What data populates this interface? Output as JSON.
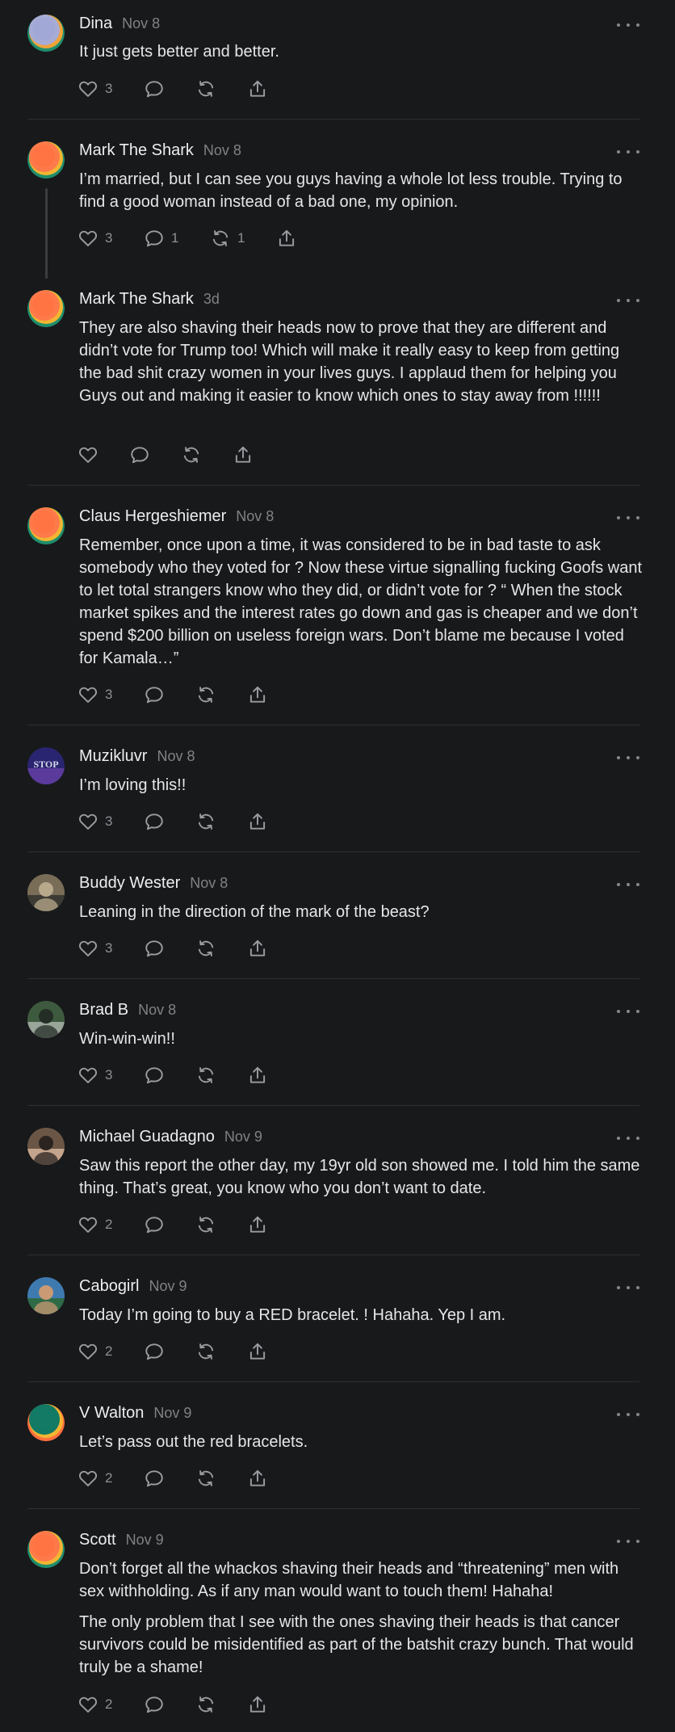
{
  "theme": {
    "background": "#18191b",
    "text": "#e9e9ea",
    "muted": "#808285",
    "divider": "#2e2f32"
  },
  "icons": {
    "like": "heart-icon",
    "reply": "comment-icon",
    "repost": "repost-icon",
    "share": "share-icon",
    "more": "more-icon"
  },
  "posts": [
    {
      "author": "Dina",
      "date": "Nov 8",
      "paragraphs": [
        "It just gets better and better."
      ],
      "likes": "3",
      "replies": "",
      "reposts": ""
    },
    {
      "author": "Mark The Shark",
      "date": "Nov 8",
      "paragraphs": [
        "I’m married, but I can see you guys having a whole lot less trouble. Trying to find a good woman instead of a bad one, my opinion."
      ],
      "likes": "3",
      "replies": "1",
      "reposts": "1"
    },
    {
      "author": "Mark The Shark",
      "date": "3d",
      "paragraphs": [
        "They are also shaving their heads now to prove that they are different and didn’t vote for Trump too! Which will make it really easy to keep from getting the bad shit crazy women in your lives guys. I applaud them for helping you Guys out and making it easier to know which ones to stay away from !!!!!!"
      ],
      "likes": "",
      "replies": "",
      "reposts": ""
    },
    {
      "author": "Claus Hergeshiemer",
      "date": "Nov 8",
      "paragraphs": [
        "Remember, once upon a time, it was considered to be in bad taste to ask somebody who they voted for ? Now these virtue signalling fucking Goofs want to let total strangers know who they did, or didn’t vote for ? “ When the stock market spikes and the interest rates go down and gas is cheaper and we don’t spend $200 billion on useless foreign wars. Don’t blame me because I voted for Kamala…”"
      ],
      "likes": "3",
      "replies": "",
      "reposts": ""
    },
    {
      "author": "Muzikluvr",
      "date": "Nov 8",
      "paragraphs": [
        "I’m loving this!!"
      ],
      "likes": "3",
      "replies": "",
      "reposts": ""
    },
    {
      "author": "Buddy Wester",
      "date": "Nov 8",
      "paragraphs": [
        "Leaning in the direction of the mark of the beast?"
      ],
      "likes": "3",
      "replies": "",
      "reposts": ""
    },
    {
      "author": "Brad B",
      "date": "Nov 8",
      "paragraphs": [
        "Win-win-win!!"
      ],
      "likes": "3",
      "replies": "",
      "reposts": ""
    },
    {
      "author": "Michael Guadagno",
      "date": "Nov 9",
      "paragraphs": [
        "Saw this report the other day, my 19yr old son showed me. I told him the same thing. That’s great, you know who you don’t want to date."
      ],
      "likes": "2",
      "replies": "",
      "reposts": ""
    },
    {
      "author": "Cabogirl",
      "date": "Nov 9",
      "paragraphs": [
        "Today I’m going to buy a RED bracelet. ! Hahaha. Yep I am."
      ],
      "likes": "2",
      "replies": "",
      "reposts": ""
    },
    {
      "author": "V Walton",
      "date": "Nov 9",
      "paragraphs": [
        "Let’s pass out the red bracelets."
      ],
      "likes": "2",
      "replies": "",
      "reposts": ""
    },
    {
      "author": "Scott",
      "date": "Nov 9",
      "paragraphs": [
        "Don’t forget all the whackos shaving their heads and “threatening” men with sex withholding. As if any man would want to touch them! Hahaha!",
        "The only problem that I see with the ones shaving their heads is that cancer survivors could be misidentified as part of the batshit crazy bunch. That would truly be a shame!"
      ],
      "likes": "2",
      "replies": "",
      "reposts": ""
    }
  ],
  "avatars": [
    {
      "kind": "swirl",
      "colors": [
        "#a7acd6",
        "#9ea5d3",
        "#f0a33a",
        "#1e8e6c"
      ]
    },
    {
      "kind": "swirl",
      "colors": [
        "#ff7a4a",
        "#ff6f3d",
        "#f2b632",
        "#1e8e6c"
      ]
    },
    {
      "kind": "swirl",
      "colors": [
        "#ff7a4a",
        "#ff6f3d",
        "#f2b632",
        "#1e8e6c"
      ]
    },
    {
      "kind": "swirl",
      "colors": [
        "#ff7a4a",
        "#ff6f3d",
        "#f2b632",
        "#1e8e6c"
      ]
    },
    {
      "kind": "stop",
      "text": "STOP",
      "colors": [
        "#2a2570",
        "#5a3b9c",
        "#d9d6ee"
      ]
    },
    {
      "kind": "photo",
      "colors": [
        "#7a6d58",
        "#b8a98c",
        "#3c3a33"
      ]
    },
    {
      "kind": "photo",
      "colors": [
        "#3e5a3e",
        "#242d26",
        "#9aa59a"
      ]
    },
    {
      "kind": "photo",
      "colors": [
        "#6b5646",
        "#2a2320",
        "#c4a48c"
      ]
    },
    {
      "kind": "photo",
      "colors": [
        "#3e7ab0",
        "#c99a74",
        "#2f6a46"
      ]
    },
    {
      "kind": "swirl",
      "colors": [
        "#127a64",
        "#137a66",
        "#f2b632",
        "#ff6f3d"
      ]
    },
    {
      "kind": "swirl",
      "colors": [
        "#ff7a4a",
        "#ff6f3d",
        "#f2b632",
        "#1e8e6c"
      ]
    }
  ]
}
